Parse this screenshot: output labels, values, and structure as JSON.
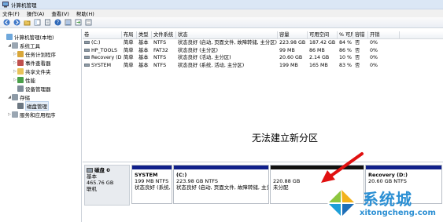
{
  "window": {
    "title": "计算机管理"
  },
  "menu": [
    "文件(F)",
    "操作(A)",
    "查看(V)",
    "帮助(H)"
  ],
  "toolbar_icons": [
    "back-icon",
    "forward-icon",
    "up-folder-icon",
    "show-tree-icon",
    "refresh-icon",
    "export-icon",
    "help-icon",
    "properties-icon",
    "view-icon"
  ],
  "tree": [
    {
      "label": "计算机管理(本地)",
      "icon": "computer-icon",
      "expander": "",
      "indent": 0
    },
    {
      "label": "系统工具",
      "icon": "tools-icon",
      "expander": "◢",
      "indent": 1
    },
    {
      "label": "任务计划程序",
      "icon": "clock-icon",
      "expander": "▷",
      "indent": 2
    },
    {
      "label": "事件查看器",
      "icon": "log-icon",
      "expander": "▷",
      "indent": 2
    },
    {
      "label": "共享文件夹",
      "icon": "folder-icon",
      "expander": "▷",
      "indent": 2
    },
    {
      "label": "性能",
      "icon": "gauge-icon",
      "expander": "▷",
      "indent": 2
    },
    {
      "label": "设备管理器",
      "icon": "device-icon",
      "expander": "",
      "indent": 2
    },
    {
      "label": "存储",
      "icon": "storage-icon",
      "expander": "◢",
      "indent": 1
    },
    {
      "label": "磁盘管理",
      "icon": "disk-icon",
      "expander": "",
      "indent": 2,
      "selected": true
    },
    {
      "label": "服务和应用程序",
      "icon": "services-icon",
      "expander": "▷",
      "indent": 1
    }
  ],
  "volumes": {
    "headers": [
      "卷",
      "布局",
      "类型",
      "文件系统",
      "状态",
      "容量",
      "可用空间",
      "% 可用",
      "容错",
      "开销"
    ],
    "rows": [
      [
        "(C:)",
        "简单",
        "基本",
        "NTFS",
        "状态良好 (启动, 页面文件, 故障转储, 主分区)",
        "223.98 GB",
        "187.42 GB",
        "84 %",
        "否",
        "0%"
      ],
      [
        "HP_TOOLS",
        "简单",
        "基本",
        "FAT32",
        "状态良好 (主分区)",
        "99 MB",
        "86 MB",
        "86 %",
        "否",
        "0%"
      ],
      [
        "Recovery (D:)",
        "简单",
        "基本",
        "NTFS",
        "状态良好 (活动, 主分区)",
        "20.60 GB",
        "2.14 GB",
        "10 %",
        "否",
        "0%"
      ],
      [
        "SYSTEM",
        "简单",
        "基本",
        "NTFS",
        "状态良好 (系统, 活动, 主分区)",
        "199 MB",
        "165 MB",
        "83 %",
        "否",
        "0%"
      ]
    ]
  },
  "overlay_text": "无法建立新分区",
  "disk": {
    "name": "磁盘 0",
    "type": "基本",
    "size": "465.76 GB",
    "status": "联机"
  },
  "partitions": [
    {
      "name": "SYSTEM",
      "line1": "199 MB NTFS",
      "line2": "状态良好 (系统,",
      "bar": "blue"
    },
    {
      "name": "(C:)",
      "line1": "223.98 GB NTFS",
      "line2": "状态良好 (启动, 页面文件, 故障转储, 主分区",
      "bar": "blue"
    },
    {
      "name": "",
      "line1": "220.88 GB",
      "line2": "未分配",
      "bar": "black"
    },
    {
      "name": "Recovery  (D:)",
      "line1": "20.60 GB NTFS",
      "line2": "",
      "bar": "blue"
    }
  ],
  "watermark": {
    "brand": "系统城",
    "site": "xitongcheng.com"
  }
}
